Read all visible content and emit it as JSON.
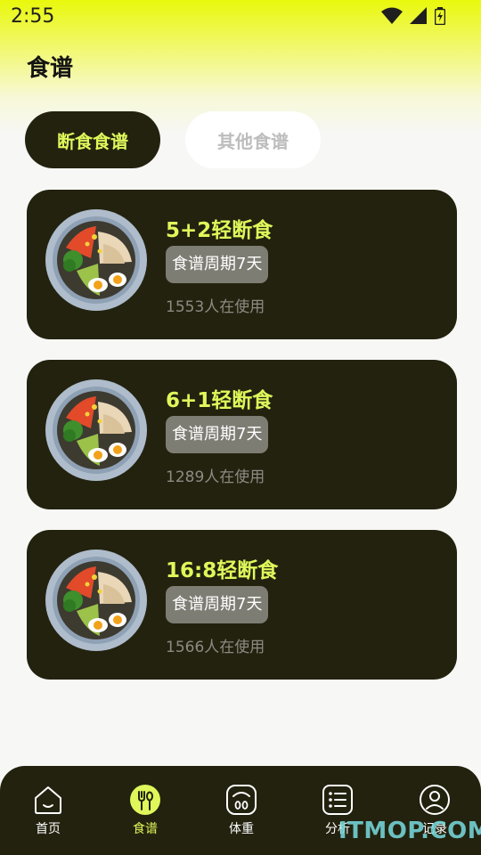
{
  "status_bar": {
    "time": "2:55"
  },
  "page": {
    "title": "食谱"
  },
  "tabs": [
    {
      "label": "断食食谱",
      "active": true
    },
    {
      "label": "其他食谱",
      "active": false
    }
  ],
  "recipes": [
    {
      "title": "5+2轻断食",
      "badge": "食谱周期7天",
      "users": "1553人在使用"
    },
    {
      "title": "6+1轻断食",
      "badge": "食谱周期7天",
      "users": "1289人在使用"
    },
    {
      "title": "16:8轻断食",
      "badge": "食谱周期7天",
      "users": "1566人在使用"
    }
  ],
  "bottom_nav": [
    {
      "label": "首页",
      "icon": "home-icon",
      "active": false
    },
    {
      "label": "食谱",
      "icon": "utensils-icon",
      "active": true
    },
    {
      "label": "体重",
      "icon": "scale-icon",
      "active": false
    },
    {
      "label": "分析",
      "icon": "list-icon",
      "active": false
    },
    {
      "label": "记录",
      "icon": "profile-icon",
      "active": false
    }
  ],
  "watermark": "ITMOP.COM",
  "colors": {
    "accent": "#dff75a",
    "card_bg": "#23220f",
    "header_yellow": "#e9f80c"
  }
}
